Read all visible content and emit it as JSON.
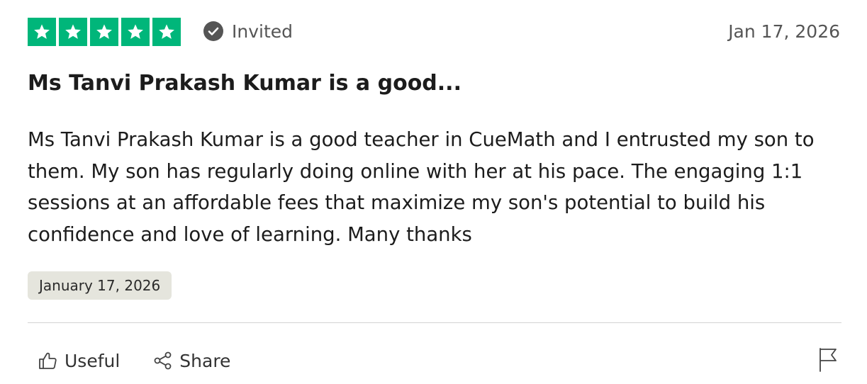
{
  "rating": {
    "stars": 5,
    "max": 5,
    "color": "#00b67a",
    "icon": "star-icon"
  },
  "status": {
    "label": "Invited",
    "icon": "check-circle-icon"
  },
  "date": "Jan 17, 2026",
  "review": {
    "title": "Ms Tanvi Prakash Kumar is a good...",
    "body": "Ms Tanvi Prakash Kumar is a good teacher in CueMath and I entrusted my son to them. My son has regularly doing online with her at his pace. The engaging 1:1 sessions at an affordable fees that maximize my son's potential to build his confidence and love of learning. Many thanks",
    "experience_date": "January 17, 2026"
  },
  "actions": {
    "useful_label": "Useful",
    "useful_icon": "thumbs-up-icon",
    "share_label": "Share",
    "share_icon": "share-icon",
    "report_icon": "flag-icon"
  }
}
